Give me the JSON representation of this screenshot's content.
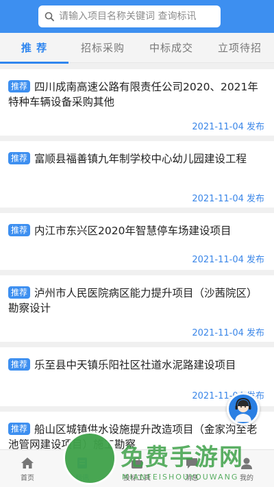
{
  "search": {
    "placeholder": "请输入项目名称关键词 查询标讯"
  },
  "tabs": [
    "推 荐",
    "招标采购",
    "中标成交",
    "立项待招"
  ],
  "badge_label": "推荐",
  "items": [
    {
      "title": "四川成南高速公路有限责任公司2020、2021年特种车辆设备采购其他",
      "date": "2021-11-04 发布"
    },
    {
      "title": "富顺县福善镇九年制学校中心幼儿园建设工程",
      "date": "2021-11-04 发布"
    },
    {
      "title": "内江市东兴区2020年智慧停车场建设项目",
      "date": "2021-11-04 发布"
    },
    {
      "title": "泸州市人民医院病区能力提升项目（沙茜院区）勘察设计",
      "date": "2021-11-04 发布"
    },
    {
      "title": "乐至县中天镇乐阳社区社道水泥路建设项目",
      "date": "2021-11-04 发布"
    },
    {
      "title": "船山区城镇供水设施提升改造项目（金家沟至老池管网建设项目）施工勘察",
      "date": ""
    }
  ],
  "bottom_nav": [
    "首页",
    "标讯",
    "投标工具",
    "消息",
    "我的"
  ],
  "watermark": {
    "main": "免费手游网",
    "sub": "MIANFEISHOUYOUWANG"
  },
  "colors": {
    "primary": "#3d8ff0",
    "watermark": "#3fa24a"
  }
}
